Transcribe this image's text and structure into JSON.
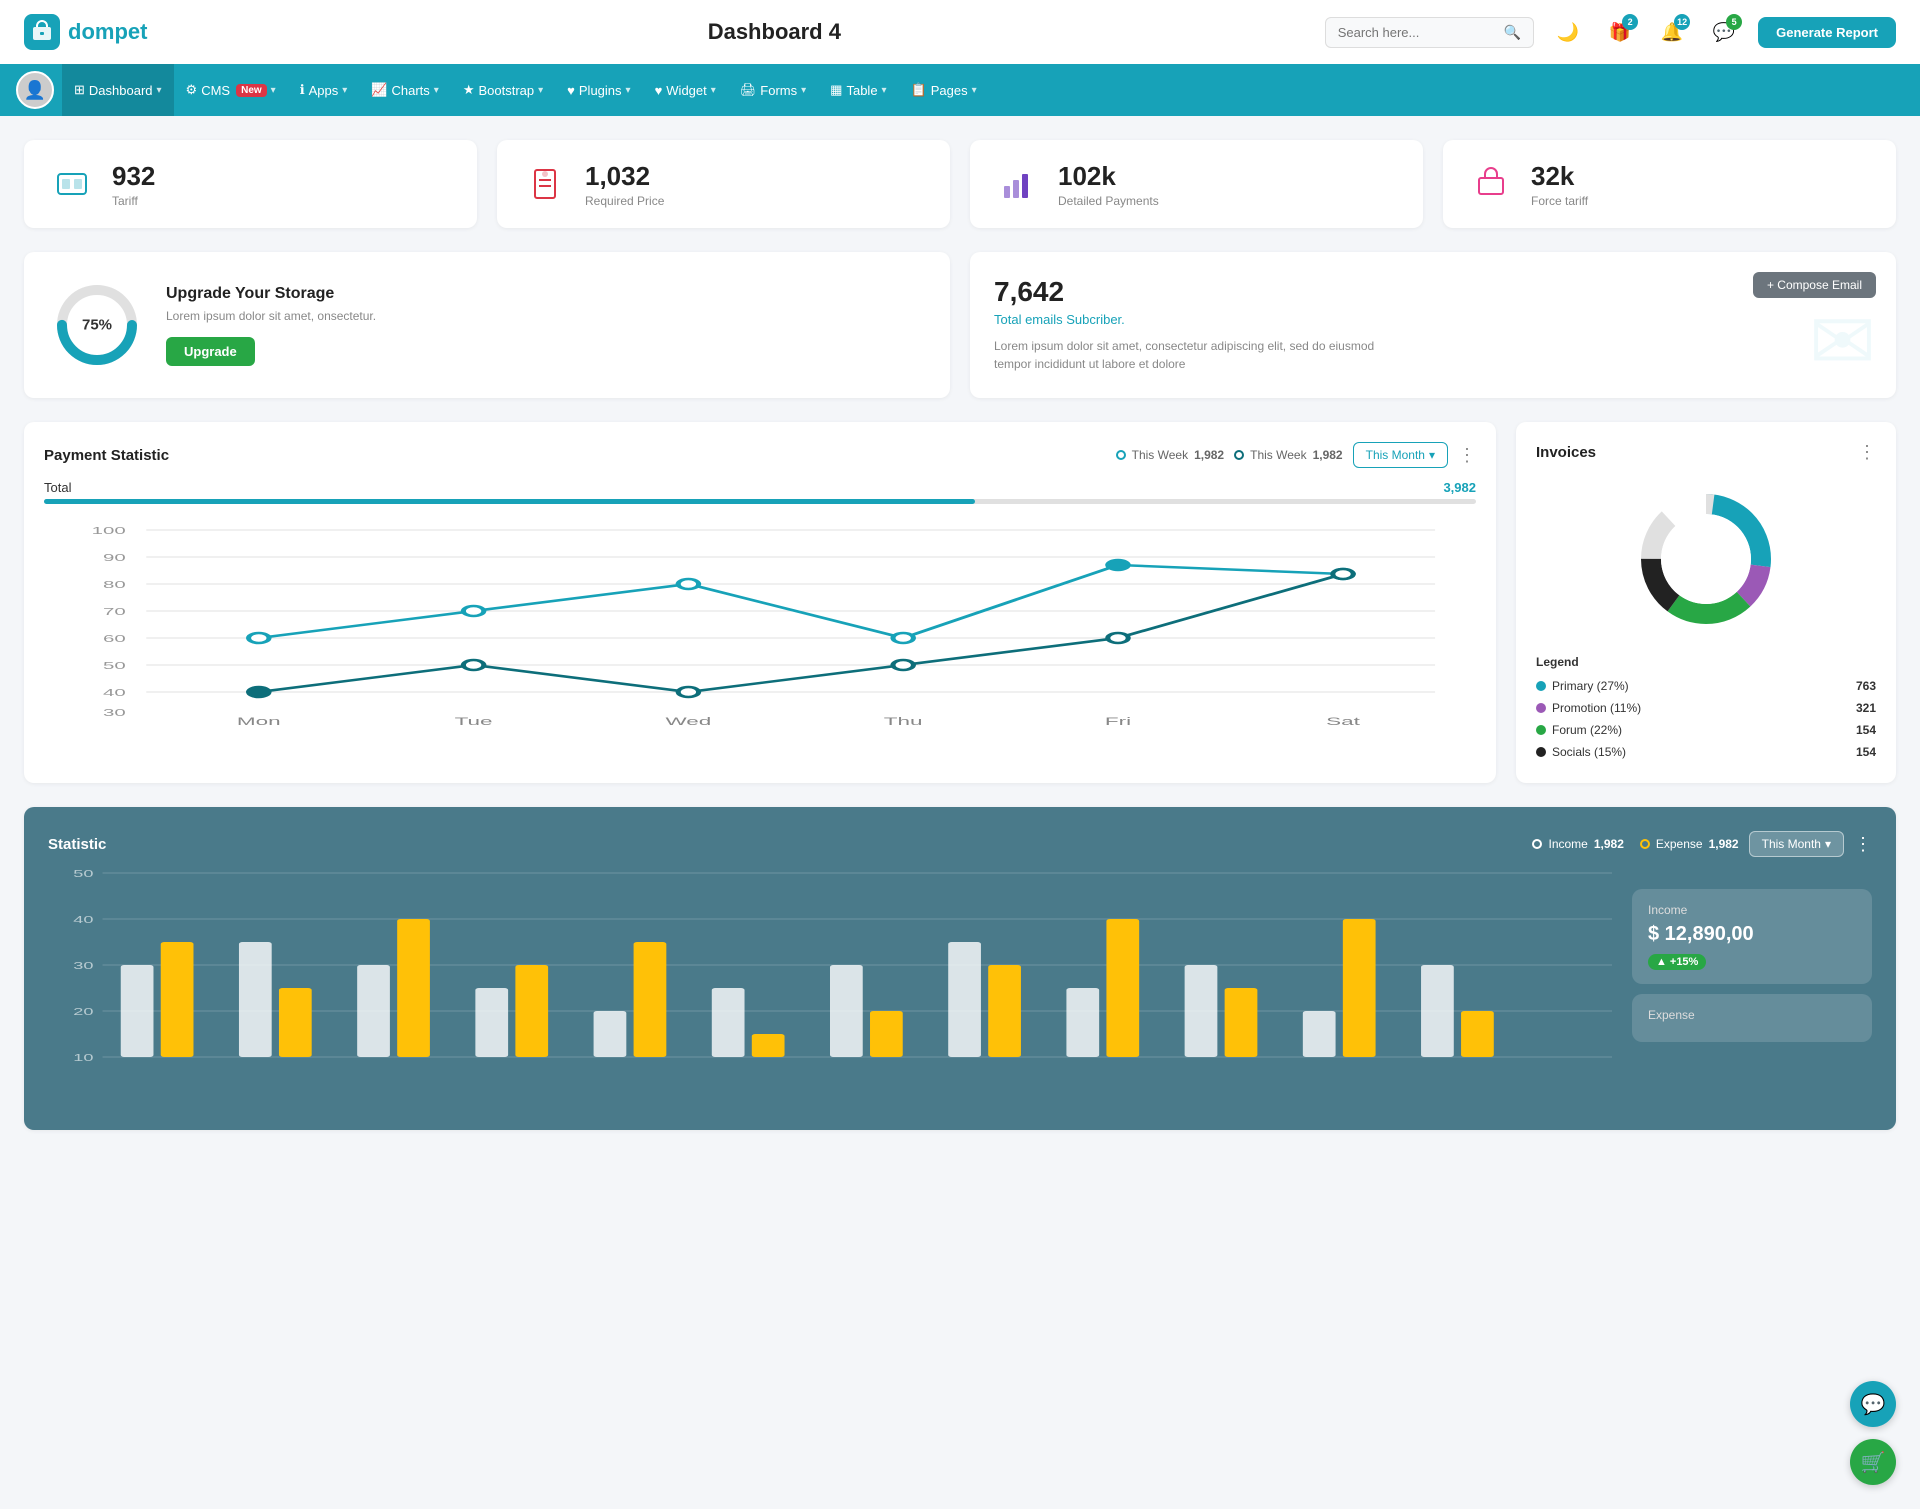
{
  "header": {
    "logo_icon": "💼",
    "logo_brand": "dompet",
    "title": "Dashboard 4",
    "search_placeholder": "Search here...",
    "generate_report_label": "Generate Report",
    "icons": {
      "moon": "🌙",
      "gift": "🎁",
      "bell": "🔔",
      "chat": "💬"
    },
    "badges": {
      "gift": "2",
      "bell": "12",
      "chat": "5"
    }
  },
  "nav": {
    "items": [
      {
        "id": "dashboard",
        "label": "Dashboard",
        "active": true,
        "has_arrow": true
      },
      {
        "id": "cms",
        "label": "CMS",
        "active": false,
        "has_new": true,
        "has_arrow": true
      },
      {
        "id": "apps",
        "label": "Apps",
        "active": false,
        "has_arrow": true
      },
      {
        "id": "charts",
        "label": "Charts",
        "active": false,
        "has_arrow": true
      },
      {
        "id": "bootstrap",
        "label": "Bootstrap",
        "active": false,
        "has_arrow": true
      },
      {
        "id": "plugins",
        "label": "Plugins",
        "active": false,
        "has_arrow": true
      },
      {
        "id": "widget",
        "label": "Widget",
        "active": false,
        "has_arrow": true
      },
      {
        "id": "forms",
        "label": "Forms",
        "active": false,
        "has_arrow": true
      },
      {
        "id": "table",
        "label": "Table",
        "active": false,
        "has_arrow": true
      },
      {
        "id": "pages",
        "label": "Pages",
        "active": false,
        "has_arrow": true
      }
    ]
  },
  "stat_cards": [
    {
      "id": "tariff",
      "value": "932",
      "label": "Tariff",
      "icon": "🗂️",
      "icon_class": "teal"
    },
    {
      "id": "required-price",
      "value": "1,032",
      "label": "Required Price",
      "icon": "📄",
      "icon_class": "red"
    },
    {
      "id": "detailed-payments",
      "value": "102k",
      "label": "Detailed Payments",
      "icon": "📊",
      "icon_class": "purple"
    },
    {
      "id": "force-tariff",
      "value": "32k",
      "label": "Force tariff",
      "icon": "🏢",
      "icon_class": "pink"
    }
  ],
  "storage": {
    "percentage": "75%",
    "title": "Upgrade Your Storage",
    "description": "Lorem ipsum dolor sit amet, onsectetur.",
    "button_label": "Upgrade",
    "donut_value": 75
  },
  "email": {
    "count": "7,642",
    "subtitle": "Total emails Subcriber.",
    "description": "Lorem ipsum dolor sit amet, consectetur adipiscing elit, sed do eiusmod tempor incididunt ut labore et dolore",
    "compose_label": "+ Compose Email"
  },
  "payment_chart": {
    "title": "Payment Statistic",
    "filter_label": "This Month",
    "legend": [
      {
        "label": "This Week",
        "value": "1,982",
        "color": "teal"
      },
      {
        "label": "This Week",
        "value": "1,982",
        "color": "dark-teal"
      }
    ],
    "total_label": "Total",
    "total_value": "3,982",
    "progress_percent": 65,
    "x_labels": [
      "Mon",
      "Tue",
      "Wed",
      "Thu",
      "Fri",
      "Sat"
    ],
    "y_labels": [
      "100",
      "90",
      "80",
      "70",
      "60",
      "50",
      "40",
      "30"
    ]
  },
  "invoices": {
    "title": "Invoices",
    "legend": [
      {
        "label": "Primary (27%)",
        "value": "763",
        "color": "#17a2b8"
      },
      {
        "label": "Promotion (11%)",
        "value": "321",
        "color": "#9b59b6"
      },
      {
        "label": "Forum (22%)",
        "value": "154",
        "color": "#28a745"
      },
      {
        "label": "Socials (15%)",
        "value": "154",
        "color": "#222"
      }
    ]
  },
  "statistic": {
    "title": "Statistic",
    "filter_label": "This Month",
    "income_label": "Income",
    "income_value": "1,982",
    "expense_label": "Expense",
    "expense_value": "1,982",
    "income_card": {
      "title": "Income",
      "value": "$ 12,890,00",
      "change": "+15%"
    },
    "expense_card": {
      "title": "Expense"
    }
  },
  "colors": {
    "primary": "#17a2b8",
    "success": "#28a745",
    "danger": "#dc3545",
    "purple": "#6f42c1",
    "pink": "#e83e8c",
    "dark": "#222",
    "nav_bg": "#17a2b8"
  }
}
